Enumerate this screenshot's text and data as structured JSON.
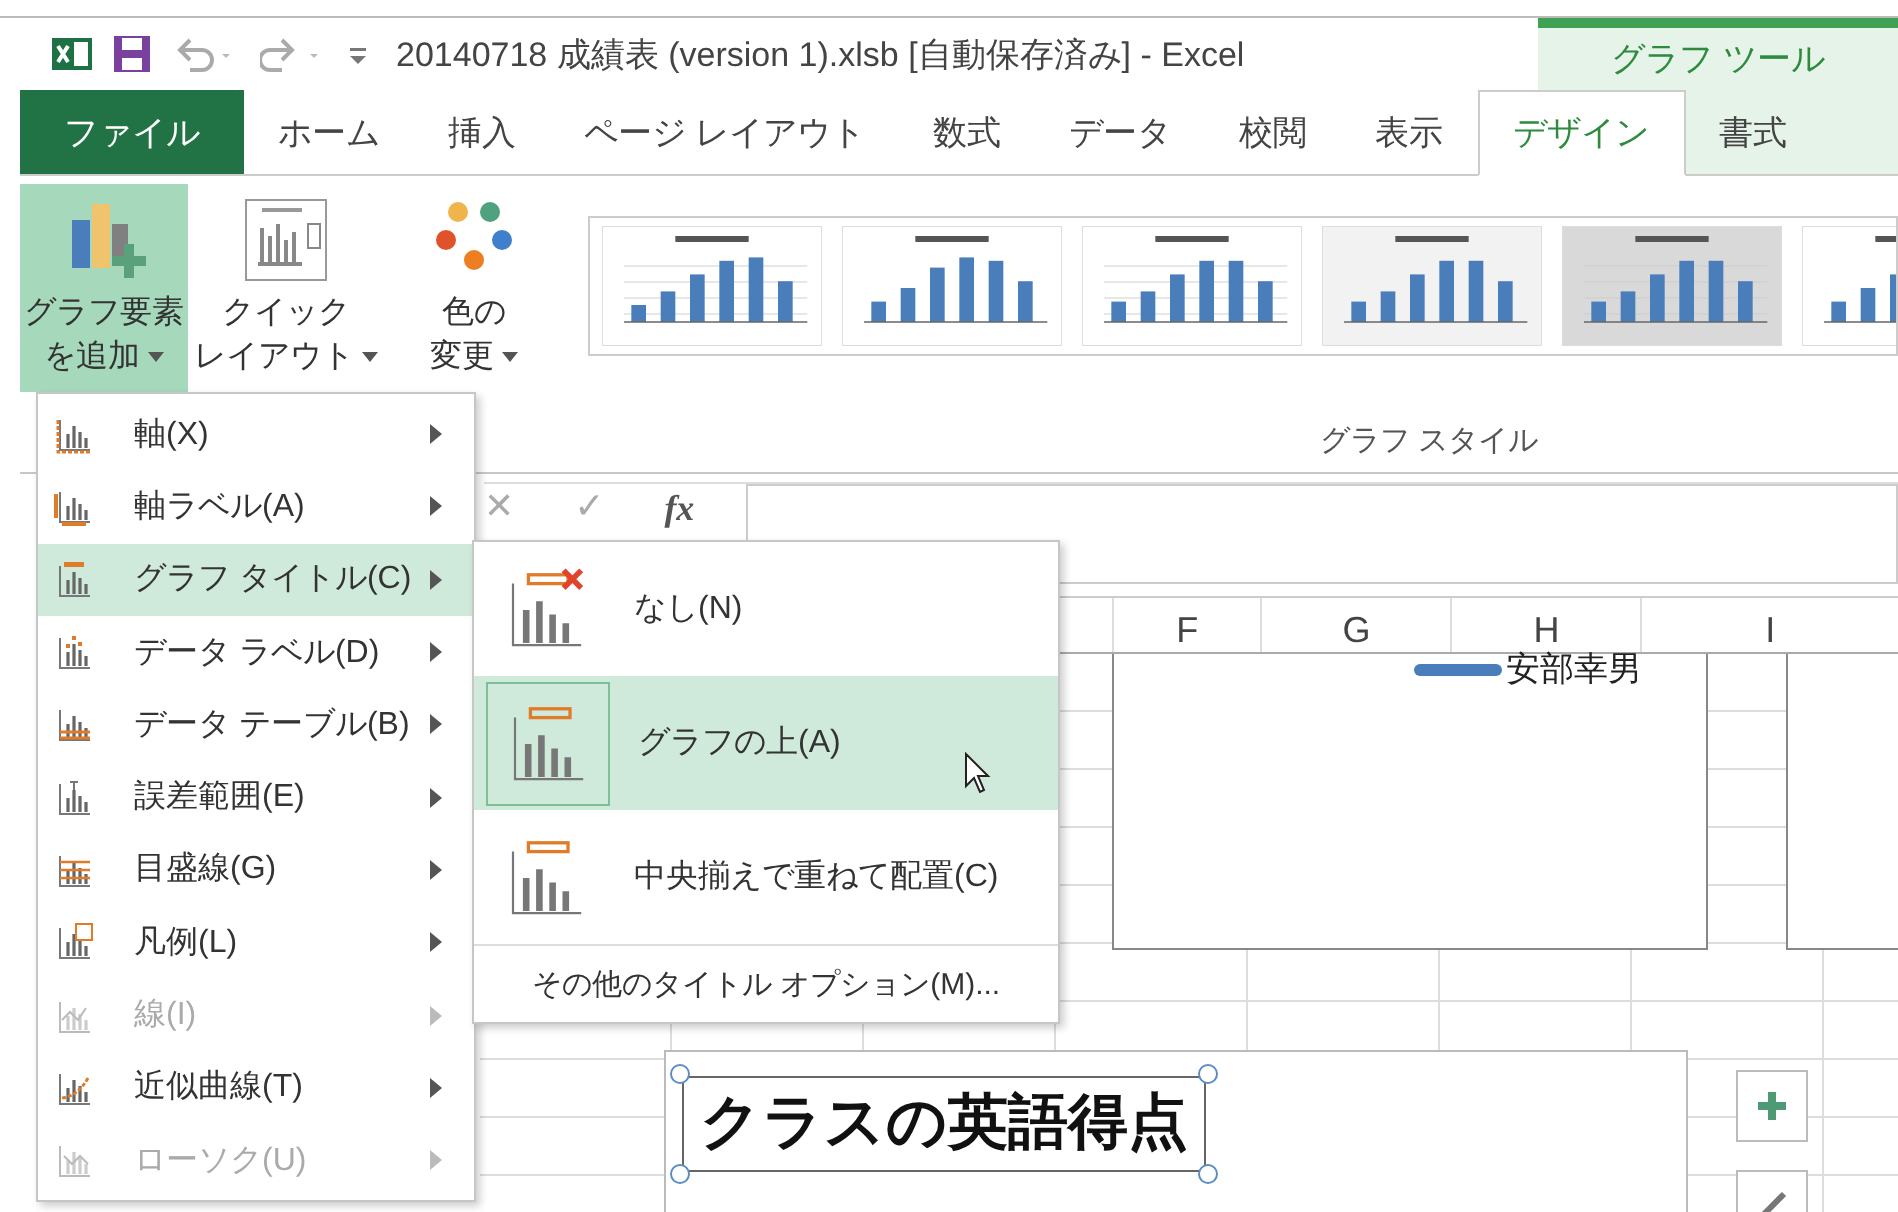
{
  "window": {
    "title": "20140718 成績表 (version 1).xlsb [自動保存済み] - Excel",
    "context_group": "グラフ ツール"
  },
  "tabs": [
    {
      "label": "ファイル",
      "kind": "file",
      "selected": false
    },
    {
      "label": "ホーム",
      "kind": "tab",
      "selected": false
    },
    {
      "label": "挿入",
      "kind": "tab",
      "selected": false
    },
    {
      "label": "ページ レイアウト",
      "kind": "tab",
      "selected": false
    },
    {
      "label": "数式",
      "kind": "tab",
      "selected": false
    },
    {
      "label": "データ",
      "kind": "tab",
      "selected": false
    },
    {
      "label": "校閲",
      "kind": "tab",
      "selected": false
    },
    {
      "label": "表示",
      "kind": "tab",
      "selected": false
    },
    {
      "label": "デザイン",
      "kind": "context",
      "selected": true
    },
    {
      "label": "書式",
      "kind": "context",
      "selected": false
    }
  ],
  "ribbon": {
    "buttons": [
      {
        "lines": [
          "グラフ要素",
          "を追加"
        ],
        "kind": "add_element",
        "pressed": true
      },
      {
        "lines": [
          "クイック",
          "レイアウト"
        ],
        "kind": "quick_layout",
        "pressed": false
      },
      {
        "lines": [
          "色の",
          "変更"
        ],
        "kind": "colors",
        "pressed": false
      }
    ],
    "group_label": "グラフ スタイル"
  },
  "formula_bar": {
    "cancel": "✕",
    "enter": "✓",
    "function": "fx"
  },
  "column_headers": [
    "F",
    "G",
    "H",
    "I"
  ],
  "chart": {
    "legend_entry": "安部幸男",
    "title": "クラスの英語得点"
  },
  "menu": {
    "items": [
      {
        "label": "軸(X)",
        "kind": "axes",
        "selected": false,
        "disabled": false
      },
      {
        "label": "軸ラベル(A)",
        "kind": "axis_titles",
        "selected": false,
        "disabled": false
      },
      {
        "label": "グラフ タイトル(C)",
        "kind": "chart_title",
        "selected": true,
        "disabled": false
      },
      {
        "label": "データ ラベル(D)",
        "kind": "data_labels",
        "selected": false,
        "disabled": false
      },
      {
        "label": "データ テーブル(B)",
        "kind": "data_table",
        "selected": false,
        "disabled": false
      },
      {
        "label": "誤差範囲(E)",
        "kind": "error_bars",
        "selected": false,
        "disabled": false
      },
      {
        "label": "目盛線(G)",
        "kind": "gridlines",
        "selected": false,
        "disabled": false
      },
      {
        "label": "凡例(L)",
        "kind": "legend",
        "selected": false,
        "disabled": false
      },
      {
        "label": "線(I)",
        "kind": "lines",
        "selected": false,
        "disabled": true
      },
      {
        "label": "近似曲線(T)",
        "kind": "trendline",
        "selected": false,
        "disabled": false
      },
      {
        "label": "ローソク(U)",
        "kind": "updown",
        "selected": false,
        "disabled": true
      }
    ]
  },
  "submenu": {
    "items": [
      {
        "label": "なし(N)",
        "kind": "none",
        "selected": false
      },
      {
        "label": "グラフの上(A)",
        "kind": "above",
        "selected": true
      },
      {
        "label": "中央揃えで重ねて配置(C)",
        "kind": "overlay",
        "selected": false
      }
    ],
    "footer": "その他のタイトル オプション(M)..."
  }
}
